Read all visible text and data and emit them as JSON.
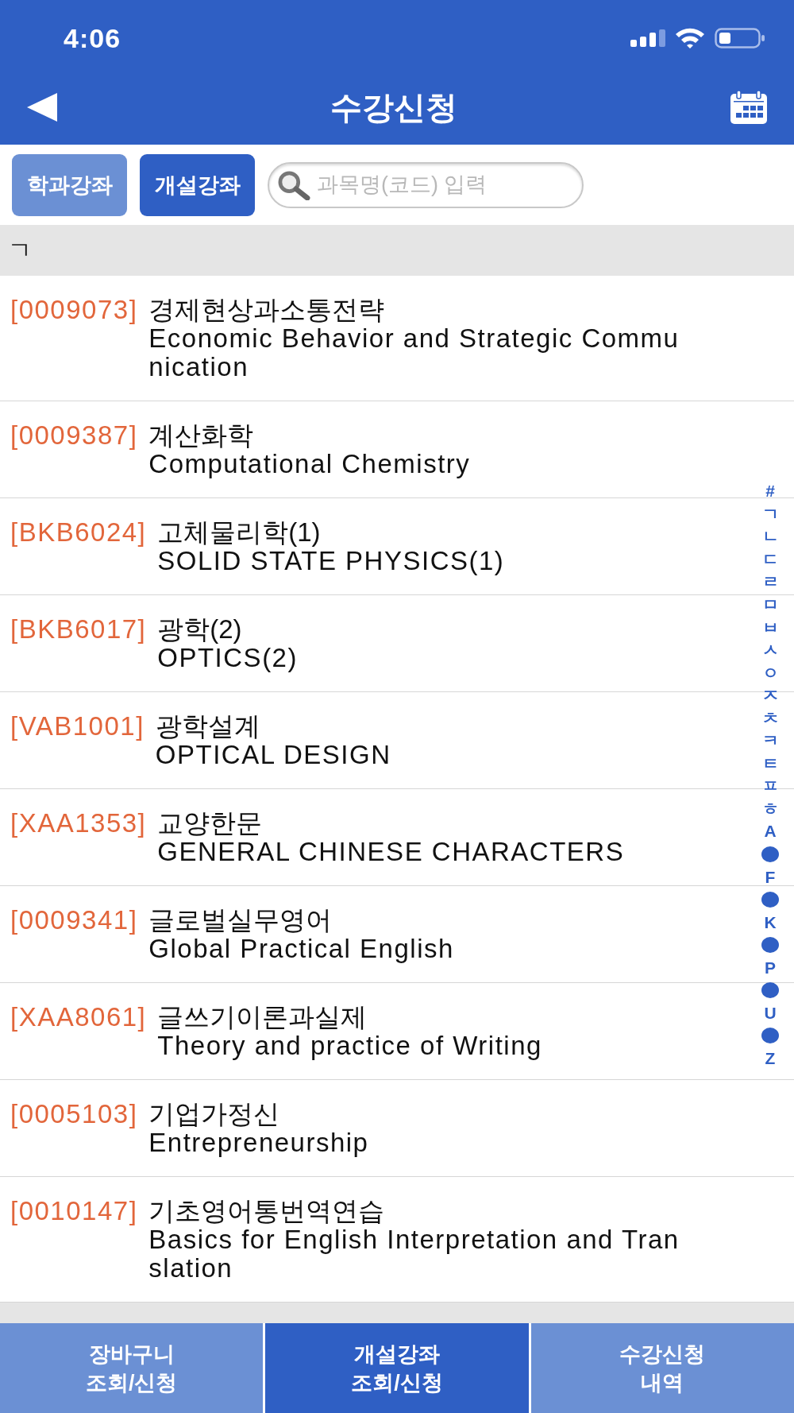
{
  "status_bar": {
    "time": "4:06"
  },
  "header": {
    "title": "수강신청"
  },
  "filter_tabs": [
    {
      "label": "학과강좌",
      "selected": false
    },
    {
      "label": "개설강좌",
      "selected": true
    }
  ],
  "search": {
    "placeholder": "과목명(코드) 입력"
  },
  "sections": [
    {
      "header": "ㄱ",
      "courses": [
        {
          "code": "[0009073]",
          "title": "경제현상과소통전략",
          "english_title": "Economic Behavior and Strategic Communication"
        },
        {
          "code": "[0009387]",
          "title": "계산화학",
          "english_title": "Computational Chemistry"
        },
        {
          "code": "[BKB6024]",
          "title": "고체물리학(1)",
          "english_title": "SOLID STATE PHYSICS(1)"
        },
        {
          "code": "[BKB6017]",
          "title": "광학(2)",
          "english_title": "OPTICS(2)"
        },
        {
          "code": "[VAB1001]",
          "title": "광학설계",
          "english_title": "OPTICAL DESIGN"
        },
        {
          "code": "[XAA1353]",
          "title": "교양한문",
          "english_title": "GENERAL CHINESE CHARACTERS"
        },
        {
          "code": "[0009341]",
          "title": "글로벌실무영어",
          "english_title": "Global Practical English"
        },
        {
          "code": "[XAA8061]",
          "title": "글쓰기이론과실제",
          "english_title": "Theory and practice of Writing"
        },
        {
          "code": "[0005103]",
          "title": "기업가정신",
          "english_title": "Entrepreneurship"
        },
        {
          "code": "[0010147]",
          "title": "기초영어통번역연습",
          "english_title": "Basics for English Interpretation and Translation"
        }
      ]
    }
  ],
  "index": [
    {
      "kind": "letter",
      "label": "#"
    },
    {
      "kind": "letter",
      "label": "ㄱ"
    },
    {
      "kind": "letter",
      "label": "ㄴ"
    },
    {
      "kind": "letter",
      "label": "ㄷ"
    },
    {
      "kind": "letter",
      "label": "ㄹ"
    },
    {
      "kind": "letter",
      "label": "ㅁ"
    },
    {
      "kind": "letter",
      "label": "ㅂ"
    },
    {
      "kind": "letter",
      "label": "ㅅ"
    },
    {
      "kind": "letter",
      "label": "ㅇ"
    },
    {
      "kind": "letter",
      "label": "ㅈ"
    },
    {
      "kind": "letter",
      "label": "ㅊ"
    },
    {
      "kind": "letter",
      "label": "ㅋ"
    },
    {
      "kind": "letter",
      "label": "ㅌ"
    },
    {
      "kind": "letter",
      "label": "ㅍ"
    },
    {
      "kind": "letter",
      "label": "ㅎ"
    },
    {
      "kind": "letter",
      "label": "A"
    },
    {
      "kind": "dot"
    },
    {
      "kind": "letter",
      "label": "F"
    },
    {
      "kind": "dot"
    },
    {
      "kind": "letter",
      "label": "K"
    },
    {
      "kind": "dot"
    },
    {
      "kind": "letter",
      "label": "P"
    },
    {
      "kind": "dot"
    },
    {
      "kind": "letter",
      "label": "U"
    },
    {
      "kind": "dot"
    },
    {
      "kind": "letter",
      "label": "Z"
    }
  ],
  "bottom_tabs": [
    {
      "lines": [
        "장바구니",
        "조회/신청"
      ],
      "selected": false
    },
    {
      "lines": [
        "개설강좌",
        "조회/신청"
      ],
      "selected": true
    },
    {
      "lines": [
        "수강신청",
        "내역"
      ],
      "selected": false
    }
  ]
}
